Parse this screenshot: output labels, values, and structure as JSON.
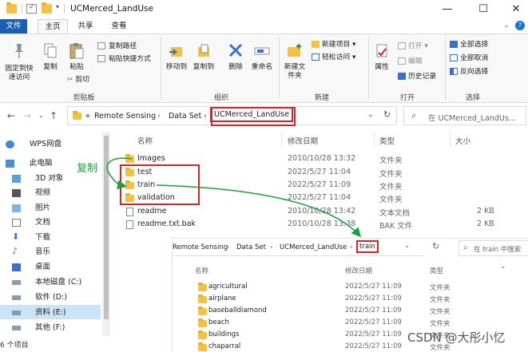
{
  "window": {
    "title": "UCMerced_LandUse",
    "controls": [
      "—",
      "☐",
      "✕"
    ]
  },
  "tabs": [
    "文件",
    "主页",
    "共享",
    "查看"
  ],
  "ribbon": {
    "clipboard": {
      "pin": "固定到快速访问",
      "copy": "复制",
      "paste": "粘贴",
      "copy_path": "复制路径",
      "paste_shortcut": "粘贴快捷方式",
      "cut": "剪切",
      "label": "剪贴板"
    },
    "organize": {
      "move_to": "移动到",
      "copy_to": "复制到",
      "delete": "删除",
      "rename": "重命名",
      "label": "组织"
    },
    "new": {
      "new_folder": "新建文件夹",
      "new_item": "新建项目 ▾",
      "easy_access": "轻松访问 ▾",
      "label": "新建"
    },
    "open": {
      "properties": "属性",
      "open": "打开 ▾",
      "edit": "编辑",
      "history": "历史记录",
      "label": "打开"
    },
    "select": {
      "select_all": "全部选择",
      "select_none": "全部取消",
      "invert": "反向选择",
      "label": "选择"
    }
  },
  "address": {
    "prefix": "«",
    "crumbs": [
      "Remote Sensing",
      "Data Set",
      "UCMerced_LandUse"
    ],
    "search_placeholder": "在 UCMerced_LandUs..."
  },
  "nav_pane": [
    {
      "label": "WPS网盘",
      "icon": "cloud-icon"
    },
    {
      "label": "此电脑",
      "icon": "computer-icon"
    },
    {
      "label": "3D 对象",
      "icon": "3d-objects-icon"
    },
    {
      "label": "视频",
      "icon": "video-icon"
    },
    {
      "label": "图片",
      "icon": "pictures-icon"
    },
    {
      "label": "文档",
      "icon": "documents-icon"
    },
    {
      "label": "下载",
      "icon": "download-icon"
    },
    {
      "label": "音乐",
      "icon": "music-icon"
    },
    {
      "label": "桌面",
      "icon": "desktop-icon"
    },
    {
      "label": "本地磁盘 (C:)",
      "icon": "drive-icon"
    },
    {
      "label": "软件 (D:)",
      "icon": "drive-icon"
    },
    {
      "label": "资料 (E:)",
      "icon": "drive-icon",
      "selected": true
    },
    {
      "label": "其他 (F:)",
      "icon": "drive-icon"
    }
  ],
  "columns": {
    "name": "名称",
    "date": "修改日期",
    "type": "类型",
    "size": "大小"
  },
  "files": [
    {
      "name": "Images",
      "date": "2010/10/28 13:32",
      "type": "文件夹",
      "size": "",
      "kind": "folder"
    },
    {
      "name": "test",
      "date": "2022/5/27 11:04",
      "type": "文件夹",
      "size": "",
      "kind": "folder"
    },
    {
      "name": "train",
      "date": "2022/5/27 11:09",
      "type": "文件夹",
      "size": "",
      "kind": "folder"
    },
    {
      "name": "validation",
      "date": "2022/5/27 11:04",
      "type": "文件夹",
      "size": "",
      "kind": "folder"
    },
    {
      "name": "readme",
      "date": "2010/10/28 13:42",
      "type": "文本文档",
      "size": "2 KB",
      "kind": "doc"
    },
    {
      "name": "readme.txt.bak",
      "date": "2010/10/28 13:38",
      "type": "BAK 文件",
      "size": "2 KB",
      "kind": "doc"
    }
  ],
  "status": "6 个项目",
  "annotation": {
    "copy_label": "复制",
    "accent": "#18a33a",
    "highlight": "#d8232a"
  },
  "second_window": {
    "crumbs": [
      "Remote Sensing",
      "Data Set",
      "UCMerced_LandUse",
      "train"
    ],
    "search_placeholder": "在 train 中搜索",
    "columns": {
      "name": "名称",
      "date": "修改日期",
      "type": "类型"
    },
    "files": [
      {
        "name": "agricultural",
        "date": "2022/5/27 11:09",
        "type": "文件夹"
      },
      {
        "name": "airplane",
        "date": "2022/5/27 11:09",
        "type": "文件夹"
      },
      {
        "name": "baseballdiamond",
        "date": "2022/5/27 11:09",
        "type": "文件夹"
      },
      {
        "name": "beach",
        "date": "2022/5/27 11:09",
        "type": "文件夹"
      },
      {
        "name": "buildings",
        "date": "2022/5/27 11:09",
        "type": "文件夹"
      },
      {
        "name": "chaparral",
        "date": "2022/5/27 11:09",
        "type": "文件夹"
      }
    ]
  },
  "watermark": "CSDN @大彤小忆"
}
